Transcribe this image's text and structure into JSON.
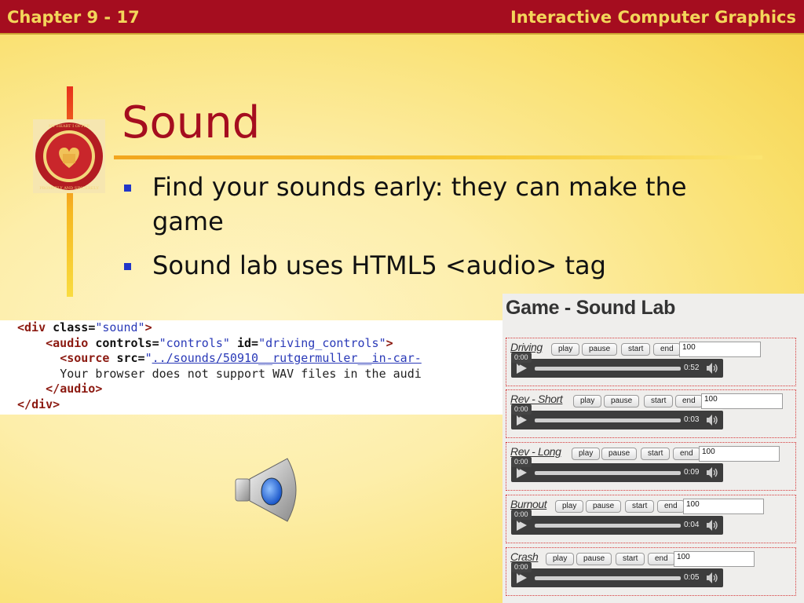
{
  "header": {
    "left": "Chapter 9 - 17",
    "right": "Interactive Computer Graphics"
  },
  "slide": {
    "title": "Sound",
    "bullets": [
      "Find your sounds early: they can make the game",
      "Sound lab uses HTML5 <audio> tag"
    ]
  },
  "code": {
    "l1_open": "<",
    "l1_tag": "div",
    "l1_attr": "class",
    "l1_eq": "=",
    "l1_val": "\"sound\"",
    "l1_close": ">",
    "l2_open": "<",
    "l2_tag": "audio",
    "l2_attr1": "controls",
    "l2_eq1": "=",
    "l2_val1": "\"controls\"",
    "l2_attr2": "id",
    "l2_eq2": "=",
    "l2_val2": "\"driving_controls\"",
    "l2_close": ">",
    "l3_open": "<",
    "l3_tag": "source",
    "l3_attr": "src",
    "l3_eq": "=",
    "l3_q": "\"",
    "l3_link": "../sounds/50910__rutgermuller__in-car-",
    "l4_text": "Your browser does not support WAV files in the audi",
    "l5_open": "</",
    "l5_tag": "audio",
    "l5_close": ">",
    "l6_open": "</",
    "l6_tag": "div",
    "l6_close": ">"
  },
  "sound_lab": {
    "title": "Game - Sound Lab",
    "buttons": {
      "play": "play",
      "pause": "pause",
      "start": "start",
      "end": "end"
    },
    "sounds": [
      {
        "name": "Driving",
        "value": "100",
        "time": "0:00",
        "duration": "0:52"
      },
      {
        "name": "Rev - Short",
        "value": "100",
        "time": "0:00",
        "duration": "0:03"
      },
      {
        "name": "Rev - Long",
        "value": "100",
        "time": "0:00",
        "duration": "0:09"
      },
      {
        "name": "Burnout",
        "value": "100",
        "time": "0:00",
        "duration": "0:04"
      },
      {
        "name": "Crash",
        "value": "100",
        "time": "0:00",
        "duration": "0:05"
      }
    ]
  },
  "icons": {
    "seal": "university-seal-icon",
    "speaker": "speaker-icon",
    "play": "play-icon",
    "volume": "volume-icon"
  },
  "colors": {
    "header_bg": "#a50d1f",
    "header_text": "#f3d65a",
    "title": "#a50d1f",
    "bullet_marker": "#2136c8",
    "code_tag": "#8c1a11",
    "code_string": "#2a3ab8",
    "lab_border": "#d6393a"
  }
}
